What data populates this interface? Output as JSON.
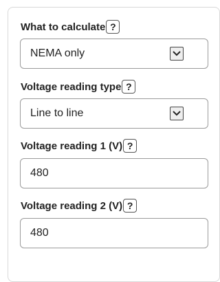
{
  "fields": [
    {
      "label": "What to calculate",
      "help": "?",
      "type": "select",
      "value": "NEMA only"
    },
    {
      "label": "Voltage reading type",
      "help": "?",
      "type": "select",
      "value": "Line to line"
    },
    {
      "label": "Voltage reading 1 (V)",
      "help": "?",
      "type": "input",
      "value": "480"
    },
    {
      "label": "Voltage reading 2 (V)",
      "help": "?",
      "type": "input",
      "value": "480"
    }
  ]
}
